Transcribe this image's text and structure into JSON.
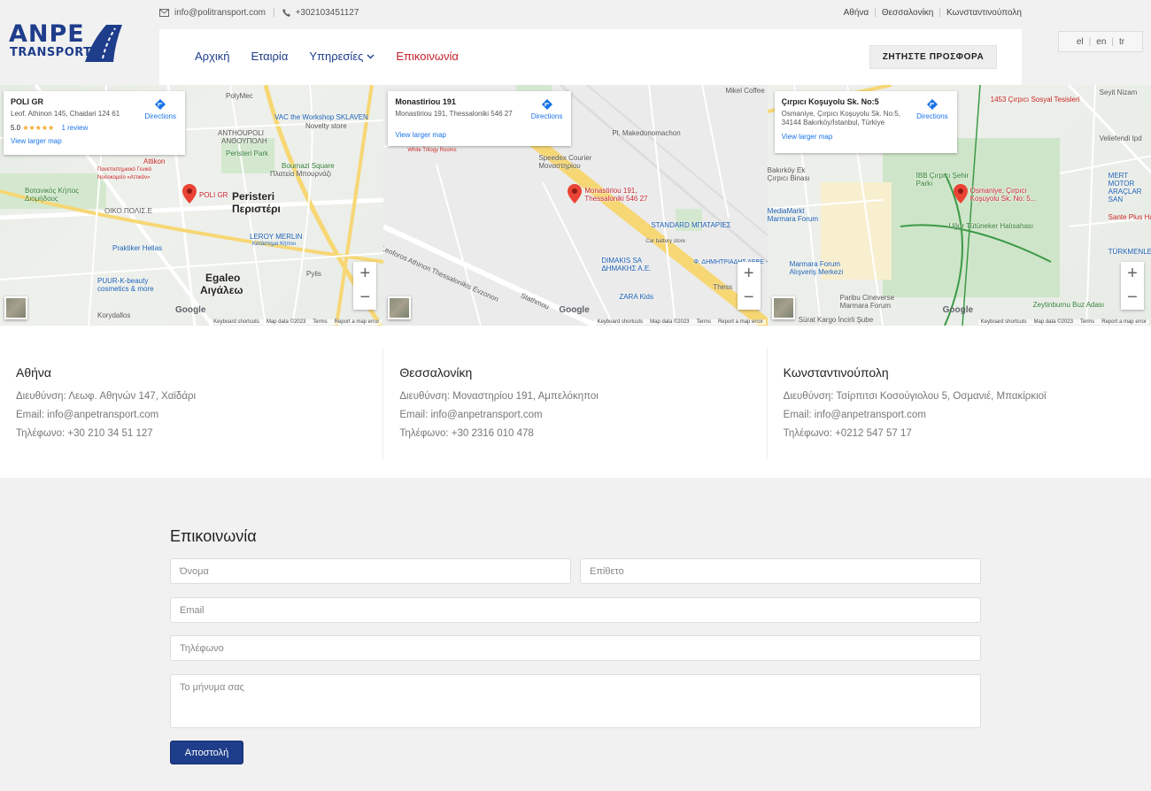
{
  "topbar": {
    "email": "info@politransport.com",
    "phone": "+302103451127",
    "cities": [
      "Αθήνα",
      "Θεσσαλονίκη",
      "Κωνσταντινούπολη"
    ]
  },
  "logo": {
    "line1": "ANPE",
    "line2": "TRANSPORT"
  },
  "nav": {
    "items": [
      {
        "label": "Αρχική"
      },
      {
        "label": "Εταιρία"
      },
      {
        "label": "Υπηρεσίες"
      },
      {
        "label": "Επικοινωνία"
      }
    ],
    "quote_button": "ΖΗΤΗΣΤΕ ΠΡΟΣΦΟΡΑ"
  },
  "languages": [
    "el",
    "en",
    "tr"
  ],
  "maps": [
    {
      "card_name": "POLI GR",
      "card_address": "Leof. Athinon 145, Chaidari 124 61",
      "rating": "5.0",
      "stars": "★★★★★",
      "reviews": "1 review",
      "directions": "Directions",
      "larger": "View larger map",
      "pin_label": "POLI GR",
      "places": {
        "peristeri": "Peristeri",
        "peristeri_gr": "Περιστέρι",
        "egaleo": "Egaleo",
        "egaleo_gr": "Αιγάλεω",
        "polymec": "PolyMec",
        "vac": "VAC the Workshop SKLAVEN",
        "novelty": "Novelty store",
        "anthoupoli": "ANTHOUPOLI",
        "anthoupoli_gr": "ΑΝΘΟΥΠΟΛΗ",
        "park": "Peristeri Park",
        "bournazi": "Bournazi Square",
        "bournazi_gr": "Πλατεία Μπουρνάζι",
        "attikon": "Attikon",
        "attikon_sub": "Πανεπιστημιακό Γενικό Νοσοκομείο «Αττικόν»",
        "botanical": "Βοτανικός Κήπος Διομήδους",
        "oikopolis": "ΟΙΚΟ.ΠΟΛΙΣ.Ε",
        "leroy": "LEROY MERLIN",
        "leroy_sub": "Κατάστημα Κήπου",
        "praktiker": "Praktiker Hellas",
        "puur": "PUUR-K-beauty cosmetics & more",
        "pylis": "Pylis",
        "korydallos": "Korydallos"
      }
    },
    {
      "card_name": "Monastiriou 191",
      "card_address": "Monastiriou 191, Thessaloniki 546 27",
      "directions": "Directions",
      "larger": "View larger map",
      "pin_label": "Monastiriou 191, Thessaloniki 546 27",
      "places": {
        "speedex": "Speedex Courier",
        "speedex_gr": "Μοναστηρίου",
        "white": "White Trilogy Rooms",
        "makedonomachon": "Pl. Makedonomachon",
        "standard": "STANDARD ΜΠΑΤΑΡΙΕΣ",
        "standard_sub": "Car battery store",
        "dimakis": "DIMAKIS SA",
        "dimakis_gr": "ΔΗΜΑΚΗΣ Α.Ε.",
        "zara": "ZARA Kids",
        "fedimmo": "Φ. ΔΗΜΗΤΡΙΑΔΗΣ ΑΕΒΕ - G",
        "thess": "Thess",
        "street": "Leoforos Athinon Thessalonikis Evzonon",
        "stathmou": "Stathmou",
        "mikel": "Mikel Coffee"
      }
    },
    {
      "card_name": "Çırpıcı Koşuyolu Sk. No:5",
      "card_address": "Osmaniye, Çırpıcı Koşuyolu Sk. No:5, 34144 Bakırköy/İstanbul, Türkiye",
      "directions": "Directions",
      "larger": "View larger map",
      "pin_label": "Osmaniye, Çırpıcı Koşuyolu Sk. No: 5...",
      "places": {
        "cirpici_sosyal": "1453 Çırpıcı Sosyal Tesisleri",
        "veliefendi": "Veliefendi Ipd",
        "mert": "MERT MOTOR ARAÇLAR SAN",
        "ibb": "İBB Çırpıcı Şehir Parkı",
        "bakirkoy": "Bakırköy Ek Çırpıcı Binası",
        "mediamarkt": "MediaMarkt Marmara Forum",
        "marmara": "Marmara Forum Alışveriş Merkezi",
        "ugur": "Uğur Tütüneker Halısahası",
        "sante": "Sante Plus Ha",
        "turkmen": "TÜRKMENLE",
        "paribu": "Paribu Cineverse Marmara Forum",
        "zeytin": "Zeytinburnu Buz Adası",
        "surat": "Sürat Kargo İncirli Şube",
        "seyit": "Seyit Nizam"
      }
    }
  ],
  "map_footer": [
    "Keyboard shortcuts",
    "Map data ©2023",
    "Terms",
    "Report a map error"
  ],
  "google": "Google",
  "offices": [
    {
      "city": "Αθήνα",
      "address": "Διευθύνση: Λεωφ. Αθηνών 147, Χαϊδάρι",
      "email": "Email: info@anpetransport.com",
      "phone": "Τηλέφωνο: +30 210 34 51 127"
    },
    {
      "city": "Θεσσαλονίκη",
      "address": "Διευθύνση: Μοναστηρίου 191, Αμπελόκηποι",
      "email": "Email: info@anpetransport.com",
      "phone": "Τηλέφωνο: +30 2316 010 478"
    },
    {
      "city": "Κωνσταντινούπολη",
      "address": "Διευθύνση: Τσίρπιτσι Κοσούγιολου 5, Οσμανιέ, Μπακίρκιοϊ",
      "email": "Email: info@anpetransport.com",
      "phone": "Τηλέφωνο: +0212 547 57 17"
    }
  ],
  "form": {
    "title": "Επικοινωνία",
    "first_name": "Όνομα",
    "last_name": "Επίθετο",
    "email": "Email",
    "phone": "Τηλέφωνο",
    "message": "Το μήνυμα σας",
    "submit": "Αποστολή"
  },
  "colors": {
    "brand": "#1e3d8a",
    "accent_red": "#c3212d"
  }
}
